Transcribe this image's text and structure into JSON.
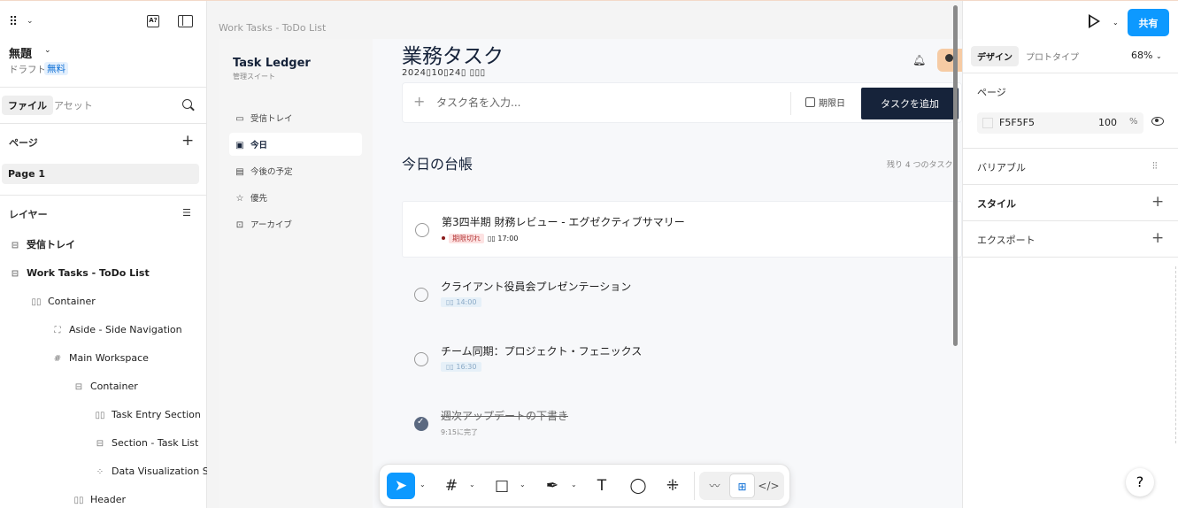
{
  "left_panel": {
    "file_name": "無題",
    "draft_label": "ドラフト",
    "plan_badge": "無料",
    "tabs": {
      "file": "ファイル",
      "assets": "アセット"
    },
    "pages_label": "ページ",
    "current_page": "Page 1",
    "layers_label": "レイヤー",
    "layers": [
      {
        "name": "受信トレイ",
        "icon": "text-layer-icon",
        "depth": 0,
        "bold": true
      },
      {
        "name": "Work Tasks - ToDo List",
        "icon": "text-layer-icon",
        "depth": 0,
        "bold": true
      },
      {
        "name": "Container",
        "icon": "auto-layout-horizontal-icon",
        "depth": 1,
        "bold": false
      },
      {
        "name": "Aside - Side Navigation",
        "icon": "frame-section-icon",
        "depth": 2,
        "bold": false
      },
      {
        "name": "Main Workspace",
        "icon": "frame-hash-icon",
        "depth": 2,
        "bold": false
      },
      {
        "name": "Container",
        "icon": "auto-layout-vertical-icon",
        "depth": 3,
        "bold": false
      },
      {
        "name": "Task Entry Section",
        "icon": "auto-layout-horizontal-icon",
        "depth": 4,
        "bold": false
      },
      {
        "name": "Section - Task List",
        "icon": "auto-layout-vertical-icon",
        "depth": 4,
        "bold": false
      },
      {
        "name": "Data Visualization S",
        "icon": "grid-icon",
        "depth": 4,
        "bold": false
      },
      {
        "name": "Header",
        "icon": "auto-layout-horizontal-icon",
        "depth": 3,
        "bold": false
      }
    ]
  },
  "canvas": {
    "frame_label": "Work Tasks - ToDo List",
    "app": {
      "brand": "Task Ledger",
      "brand_sub": "管理スイート",
      "nav": [
        {
          "label": "受信トレイ",
          "icon": "inbox-icon",
          "active": false
        },
        {
          "label": "今日",
          "icon": "calendar-icon",
          "active": true
        },
        {
          "label": "今後の予定",
          "icon": "calendar-range-icon",
          "active": false
        },
        {
          "label": "優先",
          "icon": "star-icon",
          "active": false
        },
        {
          "label": "アーカイブ",
          "icon": "archive-icon",
          "active": false
        }
      ],
      "title": "業務タスク",
      "date": "2024▯10▯24▯ ▯▯▯",
      "entry_placeholder": "タスク名を入力...",
      "due_label": "期限日",
      "add_label": "タスクを追加",
      "ledger_title": "今日の台帳",
      "ledger_count": "残り 4 つのタスク",
      "tasks": [
        {
          "name": "第3四半期 財務レビュー - エグゼクティブサマリー",
          "overdue": "期限切れ",
          "time": "▯▯ 17:00",
          "done": false,
          "card": true
        },
        {
          "name": "クライアント役員会プレゼンテーション",
          "time": "▯▯ 14:00",
          "done": false,
          "card": false
        },
        {
          "name": "チーム同期：プロジェクト・フェニックス",
          "time": "▯▯ 16:30",
          "done": false,
          "card": false
        },
        {
          "name": "週次アップデートの下書き",
          "done_text": "9:15に完了",
          "done": true,
          "card": false
        }
      ]
    }
  },
  "toolbar": {
    "tools": [
      "move-tool-icon",
      "frame-tool-icon",
      "rectangle-tool-icon",
      "pen-tool-icon",
      "text-tool-icon",
      "comment-tool-icon",
      "actions-tool-icon"
    ],
    "modes": [
      "draw-mode-icon",
      "design-mode-icon",
      "dev-mode-icon"
    ]
  },
  "right_panel": {
    "share_label": "共有",
    "tabs": {
      "design": "デザイン",
      "prototype": "プロトタイプ"
    },
    "zoom": "68%",
    "page_section": "ページ",
    "page_color": "F5F5F5",
    "page_opacity": "100",
    "opacity_unit": "%",
    "variables_label": "バリアブル",
    "styles_label": "スタイル",
    "export_label": "エクスポート",
    "help_label": "?"
  },
  "colors": {
    "accent": "#0d99ff",
    "primary_dark": "#16233a",
    "overdue_bg": "#fde2e2",
    "overdue_text": "#b33636"
  }
}
